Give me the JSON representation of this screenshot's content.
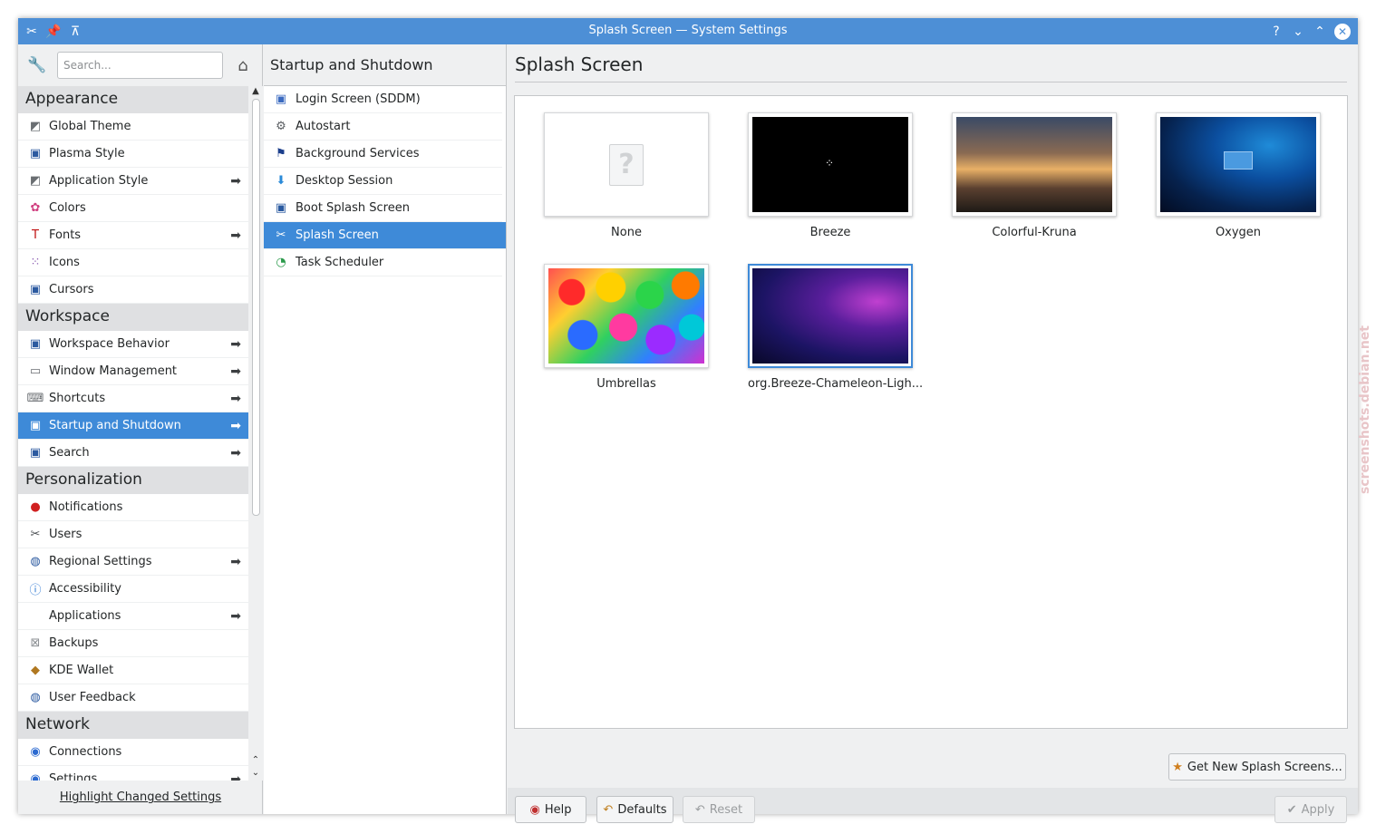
{
  "window": {
    "title": "Splash Screen — System Settings",
    "buttons": {
      "help": "?",
      "minimize": "⌄",
      "maximize": "⌃",
      "close": "✕"
    }
  },
  "sidebar": {
    "search_placeholder": "Search...",
    "categories": [
      {
        "label": "Appearance",
        "items": [
          {
            "label": "Global Theme",
            "icon": "global-theme-icon",
            "glyph": "◩",
            "color": "#6a6e72",
            "arrow": false
          },
          {
            "label": "Plasma Style",
            "icon": "plasma-style-icon",
            "glyph": "▣",
            "color": "#2c5aa0",
            "arrow": false
          },
          {
            "label": "Application Style",
            "icon": "application-style-icon",
            "glyph": "◩",
            "color": "#6a6e72",
            "arrow": true
          },
          {
            "label": "Colors",
            "icon": "colors-icon",
            "glyph": "✿",
            "color": "#d04080",
            "arrow": false
          },
          {
            "label": "Fonts",
            "icon": "fonts-icon",
            "glyph": "T",
            "color": "#c01010",
            "arrow": true
          },
          {
            "label": "Icons",
            "icon": "icons-icon",
            "glyph": "⁙",
            "color": "#8a5ab0",
            "arrow": false
          },
          {
            "label": "Cursors",
            "icon": "cursors-icon",
            "glyph": "▣",
            "color": "#2c5aa0",
            "arrow": false
          }
        ]
      },
      {
        "label": "Workspace",
        "items": [
          {
            "label": "Workspace Behavior",
            "icon": "workspace-behavior-icon",
            "glyph": "▣",
            "color": "#2c5aa0",
            "arrow": true
          },
          {
            "label": "Window Management",
            "icon": "window-management-icon",
            "glyph": "▭",
            "color": "#6a6e72",
            "arrow": true
          },
          {
            "label": "Shortcuts",
            "icon": "shortcuts-icon",
            "glyph": "⌨",
            "color": "#6a6e72",
            "arrow": true
          },
          {
            "label": "Startup and Shutdown",
            "icon": "startup-shutdown-icon",
            "glyph": "▣",
            "color": "#ffffff",
            "arrow": true,
            "selected": true
          },
          {
            "label": "Search",
            "icon": "search-settings-icon",
            "glyph": "▣",
            "color": "#2c5aa0",
            "arrow": true
          }
        ]
      },
      {
        "label": "Personalization",
        "items": [
          {
            "label": "Notifications",
            "icon": "notifications-icon",
            "glyph": "●",
            "color": "#d02020",
            "arrow": false
          },
          {
            "label": "Users",
            "icon": "users-icon",
            "glyph": "✂",
            "color": "#4a4e52",
            "arrow": false
          },
          {
            "label": "Regional Settings",
            "icon": "regional-settings-icon",
            "glyph": "◍",
            "color": "#2c5aa0",
            "arrow": true
          },
          {
            "label": "Accessibility",
            "icon": "accessibility-icon",
            "glyph": "ⓘ",
            "color": "#1f6fd0",
            "arrow": false
          },
          {
            "label": "Applications",
            "icon": "applications-icon",
            "glyph": "",
            "color": "#6a6e72",
            "arrow": true
          },
          {
            "label": "Backups",
            "icon": "backups-icon",
            "glyph": "⊠",
            "color": "#8a8e92",
            "arrow": false
          },
          {
            "label": "KDE Wallet",
            "icon": "kde-wallet-icon",
            "glyph": "◆",
            "color": "#b07820",
            "arrow": false
          },
          {
            "label": "User Feedback",
            "icon": "user-feedback-icon",
            "glyph": "◍",
            "color": "#2c5aa0",
            "arrow": false
          }
        ]
      },
      {
        "label": "Network",
        "items": [
          {
            "label": "Connections",
            "icon": "connections-icon",
            "glyph": "◉",
            "color": "#2c6ad0",
            "arrow": false
          },
          {
            "label": "Settings",
            "icon": "network-settings-icon",
            "glyph": "◉",
            "color": "#2c6ad0",
            "arrow": true
          }
        ]
      }
    ],
    "highlight_changed": "Highlight Changed Settings"
  },
  "middle": {
    "heading": "Startup and Shutdown",
    "items": [
      {
        "label": "Login Screen (SDDM)",
        "icon": "login-screen-icon",
        "glyph": "▣",
        "color": "#3a6ac0"
      },
      {
        "label": "Autostart",
        "icon": "autostart-icon",
        "glyph": "⚙",
        "color": "#5a5e62"
      },
      {
        "label": "Background Services",
        "icon": "background-services-icon",
        "glyph": "⚑",
        "color": "#1c3f8c"
      },
      {
        "label": "Desktop Session",
        "icon": "desktop-session-icon",
        "glyph": "⬇",
        "color": "#2a8ad8"
      },
      {
        "label": "Boot Splash Screen",
        "icon": "boot-splash-icon",
        "glyph": "▣",
        "color": "#2a5aa0"
      },
      {
        "label": "Splash Screen",
        "icon": "splash-screen-icon",
        "glyph": "✂",
        "color": "#ffffff",
        "selected": true
      },
      {
        "label": "Task Scheduler",
        "icon": "task-scheduler-icon",
        "glyph": "◔",
        "color": "#2a9a4a"
      }
    ]
  },
  "content": {
    "heading": "Splash Screen",
    "themes": [
      {
        "label": "None",
        "style": "none"
      },
      {
        "label": "Breeze",
        "style": "breeze"
      },
      {
        "label": "Colorful-Kruna",
        "style": "kruna"
      },
      {
        "label": "Oxygen",
        "style": "oxygen"
      },
      {
        "label": "Umbrellas",
        "style": "umbrellas"
      },
      {
        "label": "org.Breeze-Chameleon-Ligh...",
        "style": "chameleon",
        "selected": true
      }
    ],
    "get_new": "Get New Splash Screens...",
    "help": "Help",
    "defaults": "Defaults",
    "reset": "Reset",
    "apply": "Apply"
  },
  "watermark": "screenshots.debian.net"
}
